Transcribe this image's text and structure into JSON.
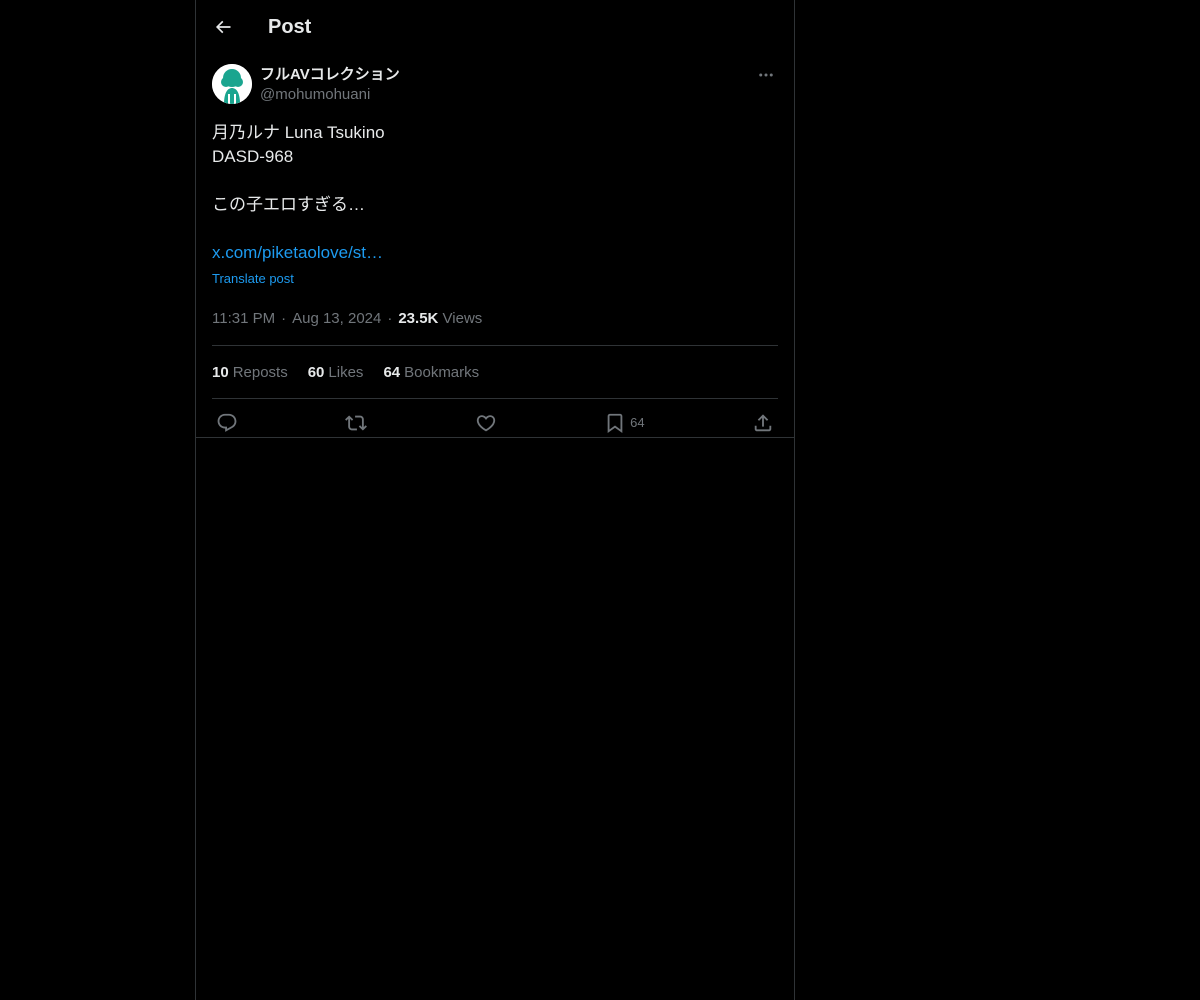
{
  "header": {
    "title": "Post"
  },
  "post": {
    "author": {
      "display_name": "フルAVコレクション",
      "handle": "@mohumohuani"
    },
    "text_lines": [
      "月乃ルナ  Luna Tsukino",
      "DASD-968",
      "",
      "この子エロすぎる…",
      ""
    ],
    "link": "x.com/piketaolove/st…",
    "translate_label": "Translate post",
    "time": "11:31 PM",
    "date": "Aug 13, 2024",
    "views_count": "23.5K",
    "views_label": "Views",
    "stats": {
      "reposts_count": "10",
      "reposts_label": "Reposts",
      "likes_count": "60",
      "likes_label": "Likes",
      "bookmarks_count": "64",
      "bookmarks_label": "Bookmarks"
    },
    "actions": {
      "bookmark_count": "64"
    }
  },
  "colors": {
    "background": "#000000",
    "text": "#e7e9ea",
    "muted": "#71767b",
    "link": "#1d9bf0",
    "border": "#2f3336",
    "avatar_figure": "#1aa58f"
  },
  "icons": [
    "back-arrow-icon",
    "more-icon",
    "reply-icon",
    "repost-icon",
    "like-icon",
    "bookmark-icon",
    "share-icon"
  ]
}
